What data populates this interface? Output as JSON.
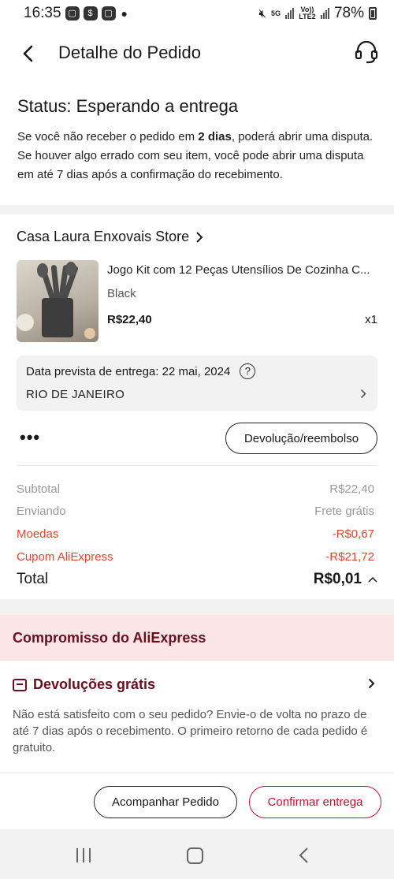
{
  "status_bar": {
    "time": "16:35",
    "network_label": "5G",
    "volte_label": "Vo)) LTE2",
    "battery": "78%"
  },
  "header": {
    "title": "Detalhe do Pedido"
  },
  "status": {
    "title": "Status: Esperando a entrega",
    "desc_prefix": "Se você não receber o pedido em ",
    "desc_bold": "2 dias",
    "desc_suffix": ", poderá abrir uma disputa. Se houver algo errado com seu item, você pode abrir uma disputa em até 7 dias após a confirmação do recebimento."
  },
  "order": {
    "store_name": "Casa Laura Enxovais Store",
    "product_name": "Jogo Kit com 12 Peças Utensílios De Cozinha C...",
    "variant": "Black",
    "price": "R$22,40",
    "quantity": "x1",
    "delivery_label": "Data prevista de entrega: 22 mai, 2024",
    "delivery_city": "RIO DE JANEIRO",
    "more_label": "•••",
    "return_button": "Devolução/reembolso"
  },
  "summary": {
    "subtotal_label": "Subtotal",
    "subtotal_value": "R$22,40",
    "shipping_label": "Enviando",
    "shipping_value": "Frete grátis",
    "coins_label": "Moedas",
    "coins_value": "-R$0,67",
    "coupon_label": "Cupom AliExpress",
    "coupon_value": "-R$21,72",
    "total_label": "Total",
    "total_value": "R$0,01"
  },
  "commitment": {
    "header": "Compromisso do AliExpress",
    "returns_title": "Devoluções grátis",
    "returns_text": "Não está satisfeito com o seu pedido? Envie-o de volta no prazo de até 7 dias após o recebimento. O primeiro retorno de cada pedido é gratuito."
  },
  "actions": {
    "track": "Acompanhar Pedido",
    "confirm": "Confirmar entrega"
  },
  "colors": {
    "accent_red": "#e5452a",
    "brand_red": "#c8102e",
    "commit_bg": "#fbe5e7",
    "commit_text": "#6b0e1e"
  }
}
